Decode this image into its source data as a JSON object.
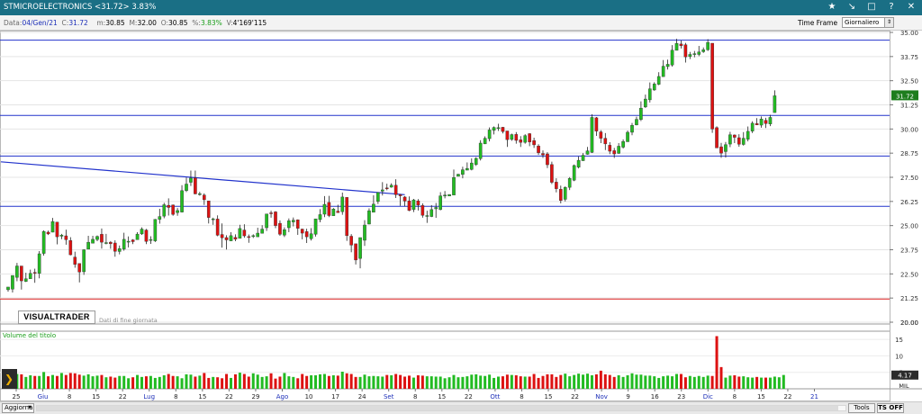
{
  "window": {
    "title": "STMICROELECTRONICS <31.72> 3.83%",
    "icons": [
      "star-icon",
      "pin-icon",
      "maximize-icon",
      "help-icon",
      "close-icon"
    ]
  },
  "info": {
    "data_label": "Data:",
    "data_value": "04/Gen/21",
    "c_label": "C:",
    "c_value": "31.72",
    "m_label": "m:",
    "m_value": "30.85",
    "M_label": "M:",
    "M_value": "32.00",
    "o_label": "O:",
    "o_value": "30.85",
    "pct_label": "%:",
    "pct_value": "3.83%",
    "v_label": "V:",
    "v_value": "4'169'115",
    "timeframe_label": "Time Frame",
    "timeframe_value": "Giornaliero"
  },
  "logo": {
    "text": "VISUALTRADER",
    "note": "Dati di fine giornata"
  },
  "footer": {
    "aggiorna": "Aggiorna",
    "tools": "Tools",
    "ts_off": "TS OFF",
    "mil": "MIL"
  },
  "colors": {
    "up": "#22bb22",
    "down": "#dd1111",
    "line": "#2233cc",
    "support": "#dd2222",
    "title_bg": "#1a6f85"
  },
  "chart_data": {
    "type": "candlestick",
    "price_axis": {
      "ticks": [
        21.25,
        22.5,
        23.75,
        25.0,
        26.25,
        27.5,
        28.75,
        30.0,
        31.25,
        32.5,
        33.75,
        35.0
      ],
      "lower_ticks": [
        20.0
      ],
      "last_price_label": "31.72"
    },
    "date_labels": [
      "25",
      "Giu",
      "8",
      "15",
      "22",
      "Lug",
      "8",
      "15",
      "22",
      "29",
      "Ago",
      "10",
      "17",
      "24",
      "Set",
      "8",
      "15",
      "22",
      "Ott",
      "8",
      "15",
      "22",
      "Nov",
      "9",
      "16",
      "23",
      "Dic",
      "8",
      "15",
      "22",
      "21"
    ],
    "highlighted_date_labels": [
      "Giu",
      "Lug",
      "Ago",
      "Set",
      "Ott",
      "Nov",
      "Dic",
      "21"
    ],
    "horizontal_lines": [
      {
        "price": 34.6,
        "color": "#2233cc"
      },
      {
        "price": 30.7,
        "color": "#2233cc"
      },
      {
        "price": 28.6,
        "color": "#2233cc"
      },
      {
        "price": 26.0,
        "color": "#2233cc"
      },
      {
        "price": 21.2,
        "color": "#dd2222"
      }
    ],
    "trendline": {
      "from": {
        "bar": 0,
        "price": 28.3
      },
      "to": {
        "bar": 89,
        "price": 26.6
      }
    },
    "candles": [
      [
        21.68,
        21.82,
        21.7,
        21.58
      ],
      [
        21.71,
        22.42,
        22.33,
        21.54
      ],
      [
        22.32,
        22.91,
        23.07,
        22.12
      ],
      [
        22.91,
        22.14,
        22.85,
        21.69
      ],
      [
        22.11,
        22.25,
        22.56,
        22.08
      ],
      [
        22.25,
        22.53,
        22.72,
        22.43
      ],
      [
        22.58,
        22.57,
        22.77,
        22.04
      ],
      [
        22.53,
        23.54,
        23.68,
        22.27
      ],
      [
        23.56,
        24.7,
        24.75,
        23.45
      ],
      [
        24.66,
        24.57,
        24.74,
        24.51
      ],
      [
        24.66,
        25.21,
        25.4,
        24.65
      ],
      [
        25.18,
        24.42,
        25.19,
        24.03
      ],
      [
        24.45,
        24.51,
        24.57,
        24.3
      ],
      [
        24.47,
        24.27,
        24.79,
        24.01
      ],
      [
        24.23,
        23.49,
        24.4,
        23.46
      ],
      [
        23.37,
        22.99,
        23.65,
        22.82
      ],
      [
        23.04,
        22.6,
        23.01,
        22.06
      ],
      [
        22.61,
        23.75,
        23.78,
        22.45
      ],
      [
        23.78,
        24.14,
        24.47,
        23.78
      ],
      [
        24.09,
        24.29,
        24.47,
        24.17
      ],
      [
        24.28,
        24.44,
        24.49,
        24.19
      ],
      [
        24.55,
        24.14,
        24.85,
        23.81
      ],
      [
        24.08,
        24.12,
        24.57,
        24.03
      ],
      [
        24.14,
        24.06,
        24.2,
        23.8
      ],
      [
        24.1,
        23.67,
        24.24,
        23.39
      ],
      [
        23.66,
        23.81,
        23.97,
        23.51
      ],
      [
        23.78,
        24.29,
        24.63,
        23.7
      ],
      [
        24.19,
        24.19,
        24.44,
        23.87
      ],
      [
        24.26,
        24.17,
        24.3,
        24.04
      ],
      [
        24.27,
        24.56,
        24.66,
        24.34
      ],
      [
        24.57,
        24.82,
        24.91,
        24.52
      ],
      [
        24.77,
        24.18,
        24.83,
        24.04
      ],
      [
        24.24,
        24.28,
        24.45,
        24.05
      ],
      [
        24.21,
        25.32,
        25.34,
        24.15
      ],
      [
        25.32,
        25.47,
        25.87,
        25.1
      ],
      [
        25.49,
        26.08,
        26.18,
        25.38
      ],
      [
        26.05,
        25.94,
        26.41,
        25.52
      ],
      [
        26.07,
        25.58,
        26.09,
        25.51
      ],
      [
        25.67,
        25.78,
        25.91,
        25.51
      ],
      [
        25.7,
        26.81,
        27.09,
        25.68
      ],
      [
        26.81,
        27.15,
        27.49,
        26.74
      ],
      [
        27.24,
        27.46,
        27.85,
        27.05
      ],
      [
        27.47,
        26.64,
        27.85,
        26.62
      ],
      [
        26.63,
        26.65,
        26.75,
        26.55
      ],
      [
        26.58,
        26.34,
        26.67,
        26.07
      ],
      [
        26.28,
        25.42,
        26.28,
        25.11
      ],
      [
        25.35,
        25.35,
        25.41,
        25.04
      ],
      [
        25.34,
        24.5,
        25.53,
        24.45
      ],
      [
        24.54,
        24.37,
        25.11,
        23.86
      ],
      [
        24.38,
        24.26,
        24.5,
        23.76
      ],
      [
        24.21,
        24.48,
        24.66,
        24.21
      ],
      [
        24.39,
        24.3,
        24.55,
        24.19
      ],
      [
        24.34,
        24.85,
        25.04,
        24.69
      ],
      [
        24.77,
        24.47,
        25.07,
        24.37
      ],
      [
        24.43,
        24.4,
        24.54,
        24.11
      ],
      [
        24.43,
        24.48,
        24.55,
        24.36
      ],
      [
        24.42,
        24.61,
        24.89,
        24.56
      ],
      [
        24.6,
        24.82,
        25.02,
        24.68
      ],
      [
        24.89,
        25.6,
        25.61,
        24.72
      ],
      [
        25.66,
        25.65,
        25.77,
        25.41
      ],
      [
        25.71,
        25.0,
        25.75,
        24.87
      ],
      [
        25.12,
        24.55,
        25.27,
        24.47
      ],
      [
        24.51,
        24.79,
        24.91,
        24.41
      ],
      [
        24.89,
        25.25,
        25.37,
        24.66
      ],
      [
        25.19,
        25.28,
        25.42,
        24.96
      ],
      [
        25.3,
        24.86,
        25.32,
        24.52
      ],
      [
        24.82,
        24.61,
        24.84,
        24.29
      ],
      [
        24.69,
        24.42,
        24.84,
        24.1
      ],
      [
        24.32,
        24.58,
        24.87,
        24.23
      ],
      [
        24.55,
        25.35,
        25.36,
        24.43
      ],
      [
        25.31,
        25.57,
        25.85,
        25.17
      ],
      [
        25.59,
        26.1,
        26.53,
        25.44
      ],
      [
        26.2,
        25.52,
        26.54,
        25.44
      ],
      [
        25.51,
        25.86,
        25.91,
        25.78
      ],
      [
        25.75,
        25.67,
        26.08,
        25.66
      ],
      [
        25.72,
        26.48,
        26.71,
        25.56
      ],
      [
        26.46,
        24.48,
        26.39,
        24.21
      ],
      [
        24.45,
        23.99,
        24.56,
        23.62
      ],
      [
        24.06,
        23.22,
        24.05,
        22.99
      ],
      [
        23.3,
        24.38,
        24.37,
        22.79
      ],
      [
        24.24,
        25.03,
        25.28,
        23.95
      ],
      [
        25.08,
        25.77,
        25.89,
        25.06
      ],
      [
        25.69,
        26.11,
        26.57,
        25.69
      ],
      [
        26.25,
        26.71,
        26.72,
        26.12
      ],
      [
        26.78,
        26.85,
        27.25,
        26.56
      ],
      [
        26.95,
        26.93,
        27.17,
        26.83
      ],
      [
        26.99,
        27.09,
        27.19,
        26.96
      ],
      [
        27.09,
        26.6,
        27.4,
        26.43
      ],
      [
        26.6,
        26.54,
        26.63,
        26.02
      ],
      [
        26.48,
        26.27,
        26.53,
        26.0
      ],
      [
        26.28,
        25.78,
        26.51,
        25.75
      ],
      [
        25.83,
        26.33,
        26.38,
        25.7
      ],
      [
        26.28,
        26.06,
        26.37,
        25.78
      ],
      [
        26.04,
        25.53,
        26.15,
        25.41
      ],
      [
        25.5,
        25.52,
        25.77,
        25.14
      ],
      [
        25.47,
        25.83,
        26.06,
        25.44
      ],
      [
        25.87,
        25.94,
        26.17,
        25.4
      ],
      [
        25.83,
        26.54,
        26.73,
        25.79
      ],
      [
        26.53,
        26.58,
        26.79,
        26.41
      ],
      [
        26.53,
        26.61,
        26.62,
        26.58
      ],
      [
        26.58,
        27.49,
        27.9,
        26.69
      ],
      [
        27.55,
        27.66,
        27.68,
        27.55
      ],
      [
        27.65,
        27.89,
        28.05,
        27.45
      ],
      [
        27.87,
        27.96,
        28.27,
        27.89
      ],
      [
        27.91,
        28.24,
        28.48,
        27.86
      ],
      [
        28.16,
        28.48,
        28.54,
        28.09
      ],
      [
        28.47,
        29.27,
        29.42,
        28.37
      ],
      [
        29.23,
        29.52,
        29.62,
        29.22
      ],
      [
        29.5,
        29.95,
        30.08,
        29.36
      ],
      [
        29.93,
        30.08,
        30.13,
        29.72
      ],
      [
        30.05,
        30.07,
        30.27,
        29.9
      ],
      [
        30.09,
        29.87,
        30.1,
        29.77
      ],
      [
        29.9,
        29.45,
        29.86,
        29.07
      ],
      [
        29.46,
        29.71,
        29.76,
        29.39
      ],
      [
        29.72,
        29.41,
        29.84,
        29.24
      ],
      [
        29.44,
        29.31,
        29.63,
        29.07
      ],
      [
        29.31,
        29.66,
        29.73,
        29.24
      ],
      [
        29.76,
        29.33,
        29.78,
        29.11
      ],
      [
        29.4,
        29.18,
        29.55,
        29.02
      ],
      [
        29.12,
        28.77,
        29.21,
        28.66
      ],
      [
        28.73,
        28.66,
        28.89,
        28.5
      ],
      [
        28.71,
        28.15,
        28.8,
        27.98
      ],
      [
        28.16,
        27.24,
        28.31,
        27.15
      ],
      [
        27.25,
        26.91,
        27.45,
        26.72
      ],
      [
        26.88,
        26.3,
        27.07,
        26.15
      ],
      [
        26.36,
        26.98,
        27.03,
        26.25
      ],
      [
        26.98,
        27.44,
        27.51,
        26.84
      ],
      [
        27.35,
        28.11,
        28.16,
        27.3
      ],
      [
        28.02,
        28.38,
        28.58,
        27.96
      ],
      [
        28.36,
        28.64,
        28.75,
        28.35
      ],
      [
        28.69,
        28.87,
        29.07,
        28.67
      ],
      [
        28.79,
        30.6,
        30.76,
        28.76
      ],
      [
        30.58,
        29.89,
        30.62,
        29.64
      ],
      [
        29.85,
        29.52,
        29.94,
        29.27
      ],
      [
        29.52,
        29.23,
        29.79,
        28.91
      ],
      [
        29.16,
        28.85,
        29.32,
        28.7
      ],
      [
        28.88,
        28.71,
        29.02,
        28.5
      ],
      [
        28.74,
        29.11,
        29.27,
        28.71
      ],
      [
        29.06,
        29.35,
        29.46,
        28.99
      ],
      [
        29.34,
        29.83,
        29.92,
        29.34
      ],
      [
        29.83,
        30.19,
        30.31,
        29.68
      ],
      [
        30.21,
        30.5,
        30.64,
        30.19
      ],
      [
        30.49,
        31.08,
        31.43,
        30.41
      ],
      [
        31.14,
        31.55,
        31.78,
        31.09
      ],
      [
        31.51,
        32.08,
        32.41,
        31.37
      ],
      [
        32.02,
        32.33,
        32.42,
        31.98
      ],
      [
        32.31,
        32.72,
        32.94,
        32.27
      ],
      [
        32.71,
        33.25,
        33.57,
        32.73
      ],
      [
        33.23,
        33.35,
        33.59,
        33.08
      ],
      [
        33.31,
        34.08,
        34.34,
        33.23
      ],
      [
        34.07,
        34.43,
        34.67,
        34.07
      ],
      [
        34.4,
        34.31,
        34.58,
        34.17
      ],
      [
        34.36,
        33.73,
        34.46,
        33.44
      ],
      [
        33.75,
        33.86,
        33.99,
        33.62
      ],
      [
        33.87,
        33.9,
        34.04,
        33.71
      ],
      [
        33.86,
        33.99,
        34.3,
        33.77
      ],
      [
        34.0,
        34.1,
        34.22,
        33.94
      ],
      [
        34.1,
        34.48,
        34.65,
        34.04
      ],
      [
        34.44,
        30.0,
        34.4,
        29.8
      ],
      [
        30.07,
        29.02,
        30.14,
        29.05
      ],
      [
        29.08,
        28.75,
        29.28,
        28.51
      ],
      [
        28.83,
        29.19,
        29.33,
        28.52
      ],
      [
        29.22,
        29.7,
        29.85,
        29.06
      ],
      [
        29.69,
        29.57,
        29.72,
        29.27
      ],
      [
        29.55,
        29.21,
        29.73,
        29.08
      ],
      [
        29.2,
        29.52,
        29.84,
        29.14
      ],
      [
        29.47,
        29.88,
        30.13,
        29.36
      ],
      [
        29.89,
        30.3,
        30.4,
        29.79
      ],
      [
        30.28,
        30.21,
        30.56,
        30.2
      ],
      [
        30.2,
        30.52,
        30.65,
        30.07
      ],
      [
        30.45,
        30.28,
        30.58,
        30.05
      ],
      [
        30.26,
        30.6,
        30.73,
        30.15
      ],
      [
        30.85,
        31.72,
        32.0,
        30.85
      ]
    ],
    "volume": {
      "title": "Volume del titolo",
      "ticks": [
        5,
        10,
        15
      ],
      "current_label": "4.17",
      "unit_label": "MIL",
      "values": [
        3.2,
        4.9,
        4.5,
        4.4,
        3.6,
        4.1,
        3.9,
        3.9,
        5.1,
        3.8,
        4.2,
        3.9,
        4.8,
        4.2,
        4.8,
        4.7,
        4.3,
        4.0,
        4.4,
        3.8,
        4.0,
        4.2,
        3.5,
        3.7,
        3.4,
        3.9,
        3.9,
        3.2,
        3.5,
        4.2,
        3.6,
        3.8,
        3.9,
        3.3,
        3.6,
        4.1,
        4.5,
        3.9,
        3.8,
        3.2,
        4.4,
        4.3,
        3.7,
        4.0,
        4.8,
        3.3,
        3.6,
        3.5,
        3.2,
        4.5,
        3.3,
        4.4,
        4.9,
        4.5,
        3.7,
        4.7,
        4.3,
        3.6,
        3.8,
        4.7,
        3.1,
        3.7,
        4.8,
        3.8,
        3.6,
        3.2,
        4.5,
        3.9,
        4.1,
        4.1,
        4.4,
        4.5,
        3.9,
        4.1,
        4.0,
        5.2,
        4.7,
        4.5,
        3.6,
        3.6,
        4.3,
        3.8,
        3.9,
        3.8,
        3.7,
        4.2,
        4.1,
        4.5,
        4.2,
        3.7,
        4.0,
        3.4,
        4.1,
        4.0,
        3.8,
        3.8,
        3.7,
        3.7,
        3.2,
        3.5,
        4.2,
        3.5,
        3.6,
        3.8,
        4.3,
        4.4,
        4.0,
        3.9,
        4.3,
        3.3,
        3.7,
        3.8,
        4.3,
        4.2,
        4.1,
        3.8,
        3.7,
        3.7,
        4.5,
        3.3,
        3.9,
        4.4,
        4.4,
        3.6,
        4.2,
        4.6,
        3.8,
        4.2,
        4.6,
        4.3,
        4.6,
        4.1,
        4.4,
        5.5,
        4.4,
        4.2,
        3.6,
        4.1,
        3.6,
        4.1,
        4.7,
        4.3,
        4.3,
        4.0,
        4.0,
        3.8,
        3.3,
        3.8,
        4.0,
        3.8,
        4.5,
        4.5,
        3.5,
        3.9,
        3.6,
        3.9,
        3.6,
        4.0,
        3.9,
        16.0,
        6.6,
        3.4,
        4.0,
        4.1,
        3.7,
        3.8,
        3.5,
        3.4,
        3.6,
        3.4,
        3.4,
        3.4,
        3.7,
        3.5,
        4.2
      ]
    }
  }
}
